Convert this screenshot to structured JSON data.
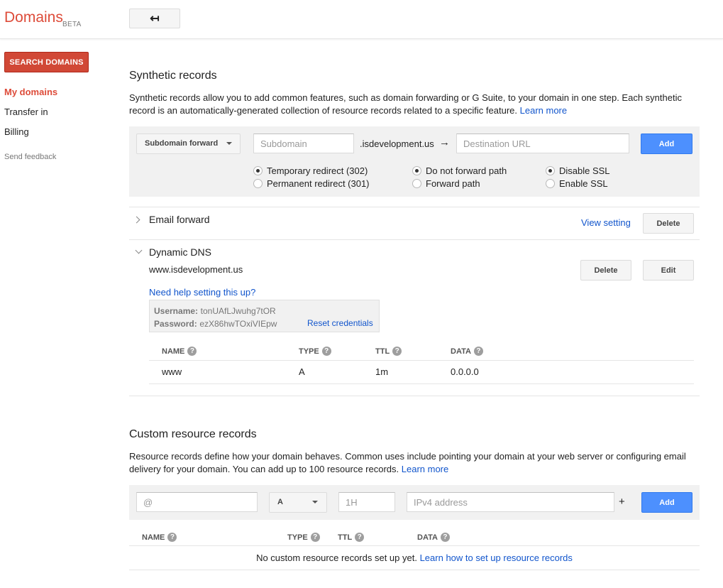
{
  "header": {
    "logo": "Domains",
    "beta": "BETA",
    "back_icon": "back-arrow-icon",
    "back_glyph": "↤"
  },
  "sidebar": {
    "search_button": "SEARCH DOMAINS",
    "items": [
      {
        "label": "My domains",
        "active": true
      },
      {
        "label": "Transfer in",
        "active": false
      },
      {
        "label": "Billing",
        "active": false
      }
    ],
    "feedback": "Send feedback"
  },
  "synthetic": {
    "title": "Synthetic records",
    "description": "Synthetic records allow you to add common features, such as domain forwarding or G Suite, to your domain in one step. Each synthetic record is an automatically-generated collection of resource records related to a specific feature.",
    "learn_more": "Learn more",
    "type_select": "Subdomain forward",
    "subdomain_placeholder": "Subdomain",
    "domain_suffix": ".isdevelopment.us",
    "arrow": "→",
    "destination_placeholder": "Destination URL",
    "add_label": "Add",
    "radios": {
      "temporary": "Temporary redirect (302)",
      "permanent": "Permanent redirect (301)",
      "no_forward_path": "Do not forward path",
      "forward_path": "Forward path",
      "disable_ssl": "Disable SSL",
      "enable_ssl": "Enable SSL"
    }
  },
  "email_forward": {
    "title": "Email forward",
    "view_setting": "View setting",
    "delete_label": "Delete"
  },
  "dynamic_dns": {
    "title": "Dynamic DNS",
    "host": "www.isdevelopment.us",
    "delete_label": "Delete",
    "edit_label": "Edit",
    "help_link": "Need help setting this up?",
    "username_label": "Username:",
    "username_value": "tonUAfLJwuhg7tOR",
    "password_label": "Password:",
    "password_value": "ezX86hwTOxiVIEpw",
    "reset_credentials": "Reset credentials",
    "table": {
      "headers": [
        "NAME",
        "TYPE",
        "TTL",
        "DATA"
      ],
      "rows": [
        [
          "www",
          "A",
          "1m",
          "0.0.0.0"
        ]
      ]
    }
  },
  "custom": {
    "title": "Custom resource records",
    "description": "Resource records define how your domain behaves. Common uses include pointing your domain at your web server or configuring email delivery for your domain. You can add up to 100 resource records.",
    "learn_more": "Learn more",
    "name_placeholder": "@",
    "type_select": "A",
    "ttl_placeholder": "1H",
    "data_placeholder": "IPv4 address",
    "plus": "+",
    "add_label": "Add",
    "table_headers": [
      "NAME",
      "TYPE",
      "TTL",
      "DATA"
    ],
    "empty_text": "No custom resource records set up yet.",
    "empty_link": "Learn how to set up resource records"
  },
  "icons": {
    "help_glyph": "?",
    "help_icon": "help-circle-icon"
  }
}
